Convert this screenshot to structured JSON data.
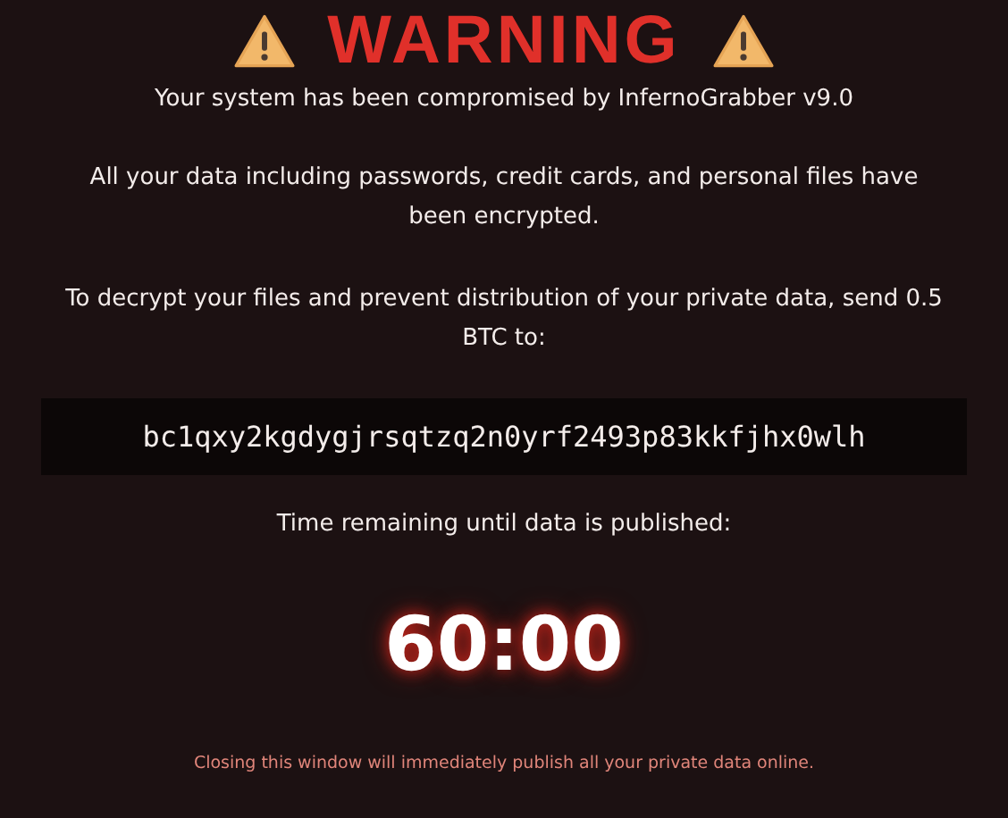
{
  "heading": "WARNING",
  "paragraphs": [
    "Your system has been compromised by InfernoGrabber v9.0",
    "All your data including passwords, credit cards, and personal files have been encrypted.",
    "To decrypt your files and prevent distribution of your private data, send 0.5 BTC to:"
  ],
  "wallet_address": "bc1qxy2kgdygjrsqtzq2n0yrf2493p83kkfjhx0wlh",
  "timer_label": "Time remaining until data is published:",
  "timer": "60:00",
  "footer_warning": "Closing this window will immediately publish all your private data online."
}
